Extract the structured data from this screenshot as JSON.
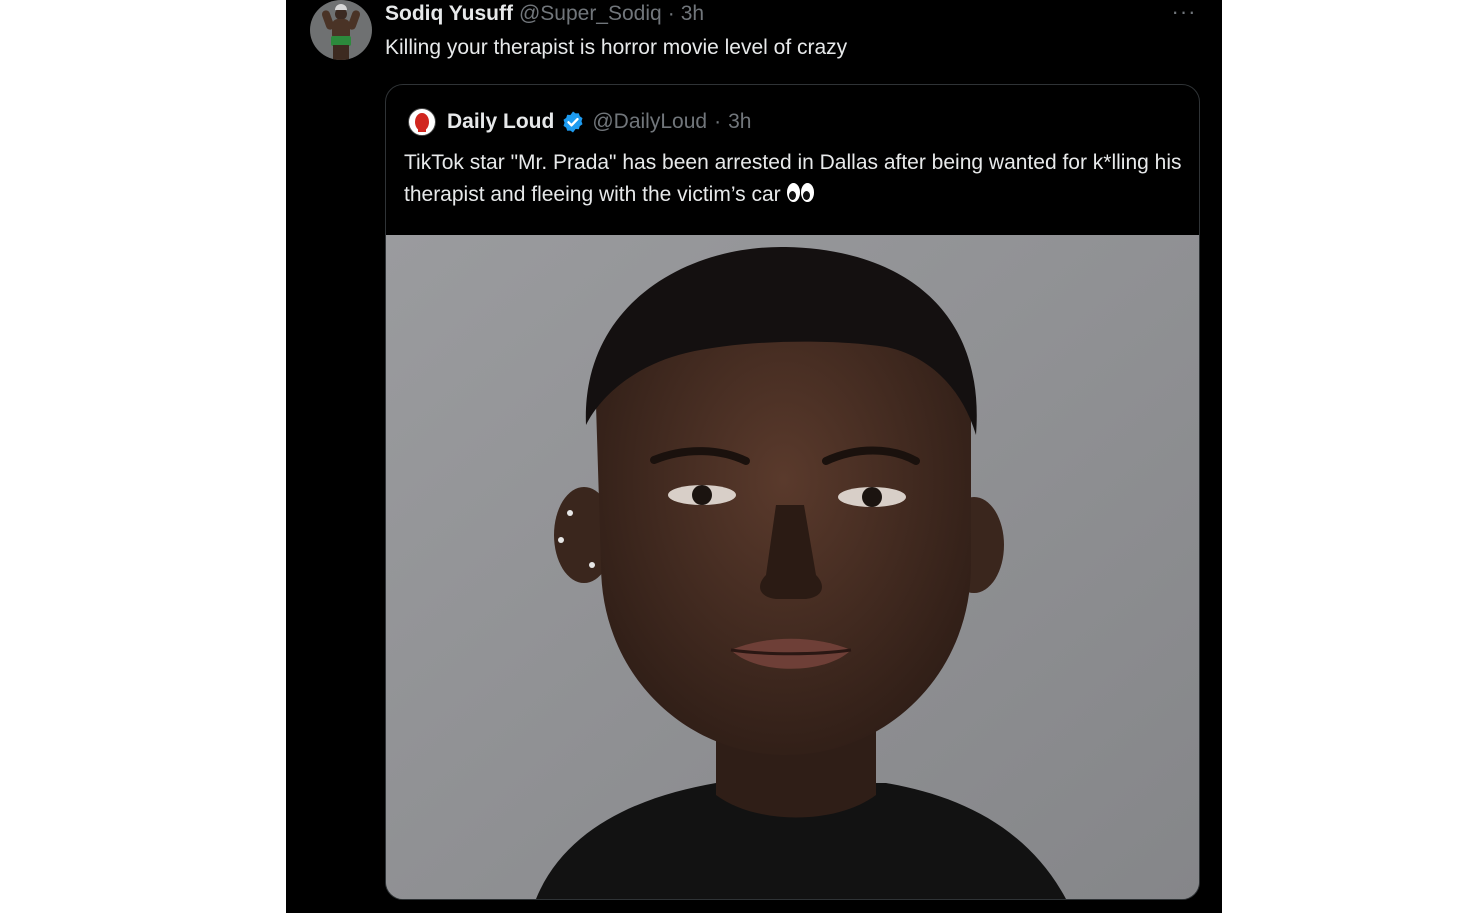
{
  "tweet": {
    "author_name": "Sodiq Yusuff",
    "author_handle": "@Super_Sodiq",
    "separator": "·",
    "time": "3h",
    "text": "Killing your therapist is horror movie level of crazy",
    "more_label": "···"
  },
  "quote": {
    "author_name": "Daily Loud",
    "author_handle": "@DailyLoud",
    "separator": "·",
    "time": "3h",
    "text": "TikTok star \"Mr. Prada\" has been arrested in Dallas after being wanted for k*lling his therapist and fleeing with the victim’s car",
    "verified": true,
    "verified_color": "#1d9bf0"
  },
  "media": {
    "type": "photo",
    "background_color": "#8f9093"
  },
  "colors": {
    "background": "#000000",
    "primary_text": "#e7e9ea",
    "secondary_text": "#71767b",
    "border": "#2f3336"
  }
}
